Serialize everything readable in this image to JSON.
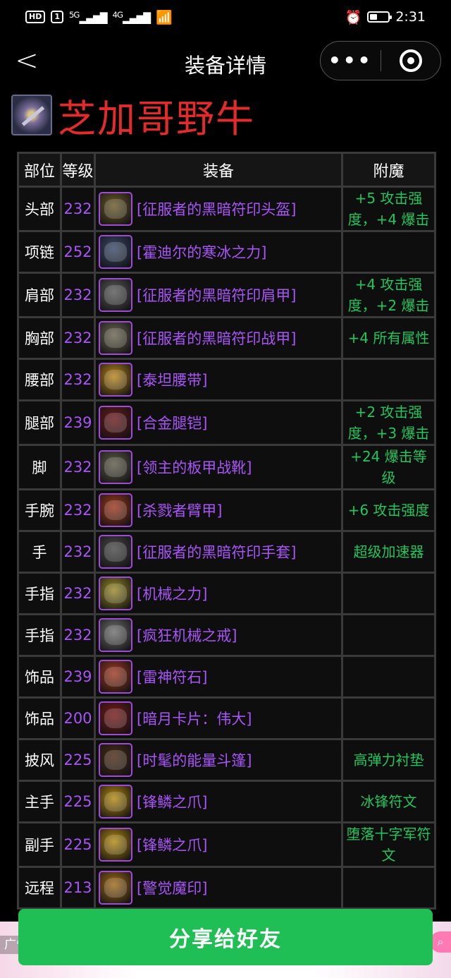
{
  "status_bar": {
    "hd_badge": "HD",
    "sim1": "1",
    "signal1": "5G",
    "signal2": "4G",
    "time": "2:31"
  },
  "nav": {
    "back_glyph": "<",
    "title": "装备详情",
    "more_glyph": "•••"
  },
  "character": {
    "name": "芝加哥野牛"
  },
  "table": {
    "headers": [
      "部位",
      "等级",
      "装备",
      "附魔"
    ],
    "rows": [
      {
        "slot": "头部",
        "level": "232",
        "item": "[征服者的黑暗符印头盔]",
        "enchant": "+5 攻击强度，+4 爆击",
        "icon_color": "#6b5a2a"
      },
      {
        "slot": "项链",
        "level": "252",
        "item": "[霍迪尔的寒冰之力]",
        "enchant": "",
        "icon_color": "#3b4a6b"
      },
      {
        "slot": "肩部",
        "level": "232",
        "item": "[征服者的黑暗符印肩甲]",
        "enchant": "+4 攻击强度，+2 爆击",
        "icon_color": "#5a5a5a"
      },
      {
        "slot": "胸部",
        "level": "232",
        "item": "[征服者的黑暗符印战甲]",
        "enchant": "+4 所有属性",
        "icon_color": "#6a6552"
      },
      {
        "slot": "腰部",
        "level": "232",
        "item": "[泰坦腰带]",
        "enchant": "",
        "icon_color": "#b8861b"
      },
      {
        "slot": "腿部",
        "level": "239",
        "item": "[合金腿铠]",
        "enchant": "+2 攻击强度，+3 爆击",
        "icon_color": "#6b1b1f"
      },
      {
        "slot": "脚",
        "level": "232",
        "item": "[领主的板甲战靴]",
        "enchant": "+24 爆击等级",
        "icon_color": "#5e5b4a"
      },
      {
        "slot": "手腕",
        "level": "232",
        "item": "[杀戮者臂甲]",
        "enchant": "+6 攻击强度",
        "icon_color": "#a0381e"
      },
      {
        "slot": "手",
        "level": "232",
        "item": "[征服者的黑暗符印手套]",
        "enchant": "超级加速器",
        "icon_color": "#4a4a4a"
      },
      {
        "slot": "手指",
        "level": "232",
        "item": "[机械之力]",
        "enchant": "",
        "icon_color": "#9a8a2a"
      },
      {
        "slot": "手指",
        "level": "232",
        "item": "[疯狂机械之戒]",
        "enchant": "",
        "icon_color": "#707070"
      },
      {
        "slot": "饰品",
        "level": "239",
        "item": "[雷神符石]",
        "enchant": "",
        "icon_color": "#a03a22"
      },
      {
        "slot": "饰品",
        "level": "200",
        "item": "[暗月卡片：伟大]",
        "enchant": "",
        "icon_color": "#7a1a1a"
      },
      {
        "slot": "披风",
        "level": "225",
        "item": "[时髦的能量斗篷]",
        "enchant": "高弹力衬垫",
        "icon_color": "#4a2c18"
      },
      {
        "slot": "主手",
        "level": "225",
        "item": "[锋鳞之爪]",
        "enchant": "冰锋符文",
        "icon_color": "#b48a12"
      },
      {
        "slot": "副手",
        "level": "225",
        "item": "[锋鳞之爪]",
        "enchant": "堕落十字军符文",
        "icon_color": "#b48a12"
      },
      {
        "slot": "远程",
        "level": "213",
        "item": "[警觉魔印]",
        "enchant": "",
        "icon_color": "#a06a1a"
      }
    ]
  },
  "ad": {
    "label": "广告⌄"
  },
  "share_button": {
    "label": "分享给好友"
  },
  "colors": {
    "item_purple": "#a855f7",
    "enchant_green": "#22c55e",
    "name_red": "#e32b2b",
    "button_green": "#1fbf55"
  }
}
